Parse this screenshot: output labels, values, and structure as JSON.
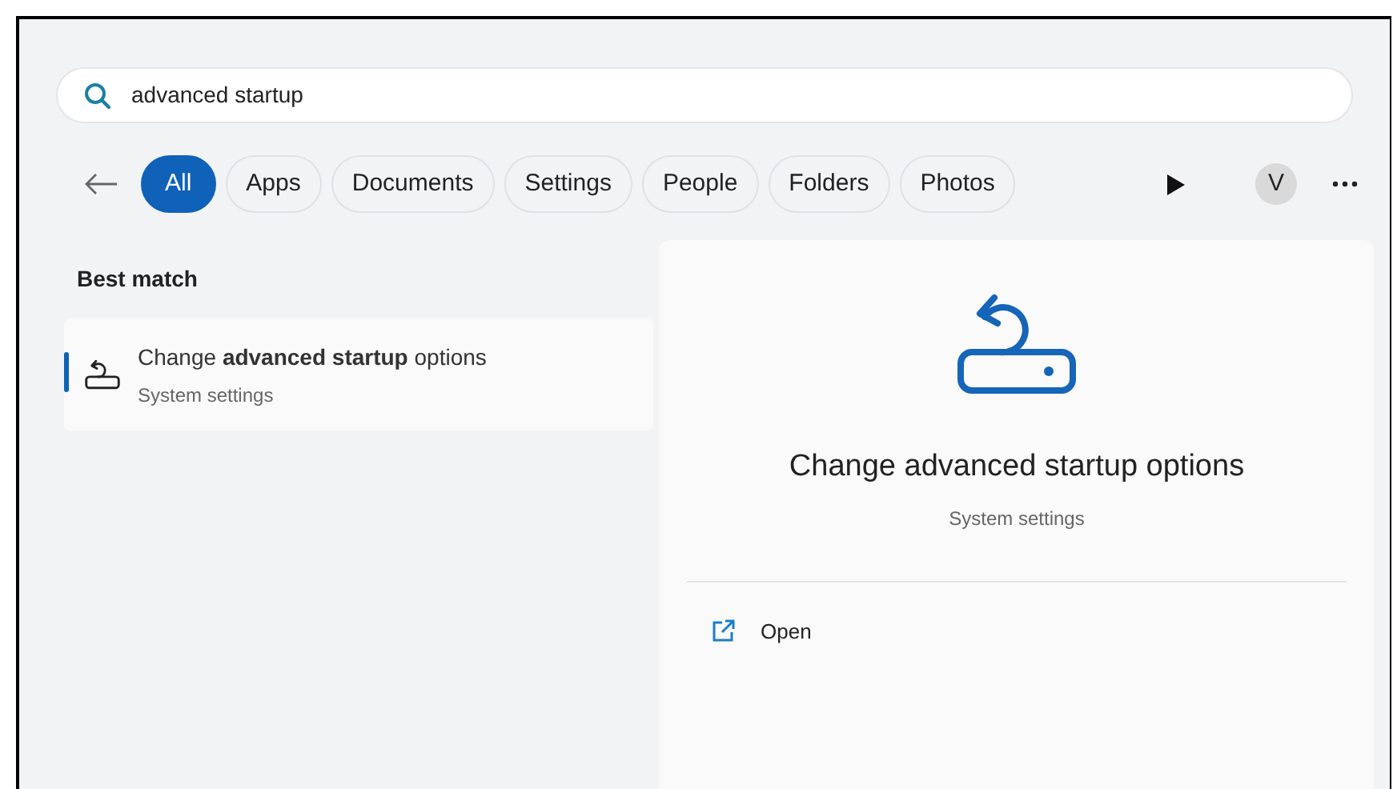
{
  "search": {
    "value": "advanced startup"
  },
  "filters": [
    {
      "label": "All",
      "selected": true
    },
    {
      "label": "Apps",
      "selected": false
    },
    {
      "label": "Documents",
      "selected": false
    },
    {
      "label": "Settings",
      "selected": false
    },
    {
      "label": "People",
      "selected": false
    },
    {
      "label": "Folders",
      "selected": false
    },
    {
      "label": "Photos",
      "selected": false
    }
  ],
  "account": {
    "initial": "V"
  },
  "best_match": {
    "heading": "Best match",
    "results": [
      {
        "title": "Change **advanced startup** options",
        "subtitle": "System settings",
        "selected": true
      }
    ]
  },
  "detail": {
    "title": "Change advanced startup options",
    "subtitle": "System settings",
    "actions": [
      {
        "label": "Open"
      }
    ]
  }
}
